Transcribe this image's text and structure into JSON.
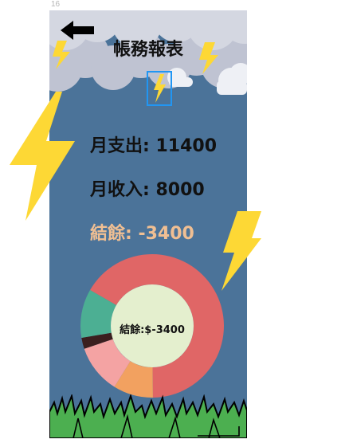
{
  "artboard": {
    "label": "16"
  },
  "header": {
    "title": "帳務報表",
    "back_icon": "left-arrow-icon"
  },
  "stats": {
    "expense": "月支出: 11400",
    "income": "月收入: 8000",
    "balance": "結餘: -3400"
  },
  "chart_data": {
    "type": "pie",
    "center_label": "結餘:$-3400",
    "slices": [
      {
        "value": 66.5,
        "color": "#e06666"
      },
      {
        "value": 9,
        "color": "#f2a160"
      },
      {
        "value": 11,
        "color": "#f4a3a3"
      },
      {
        "value": 2.5,
        "color": "#3b1f1f"
      },
      {
        "value": 11,
        "color": "#4caf93"
      }
    ]
  },
  "colors": {
    "background": "#4b7399",
    "cloud": "#c9ccd8",
    "bolt": "#fdd835",
    "grass": "#4caf50",
    "selection": "#2196f3"
  }
}
